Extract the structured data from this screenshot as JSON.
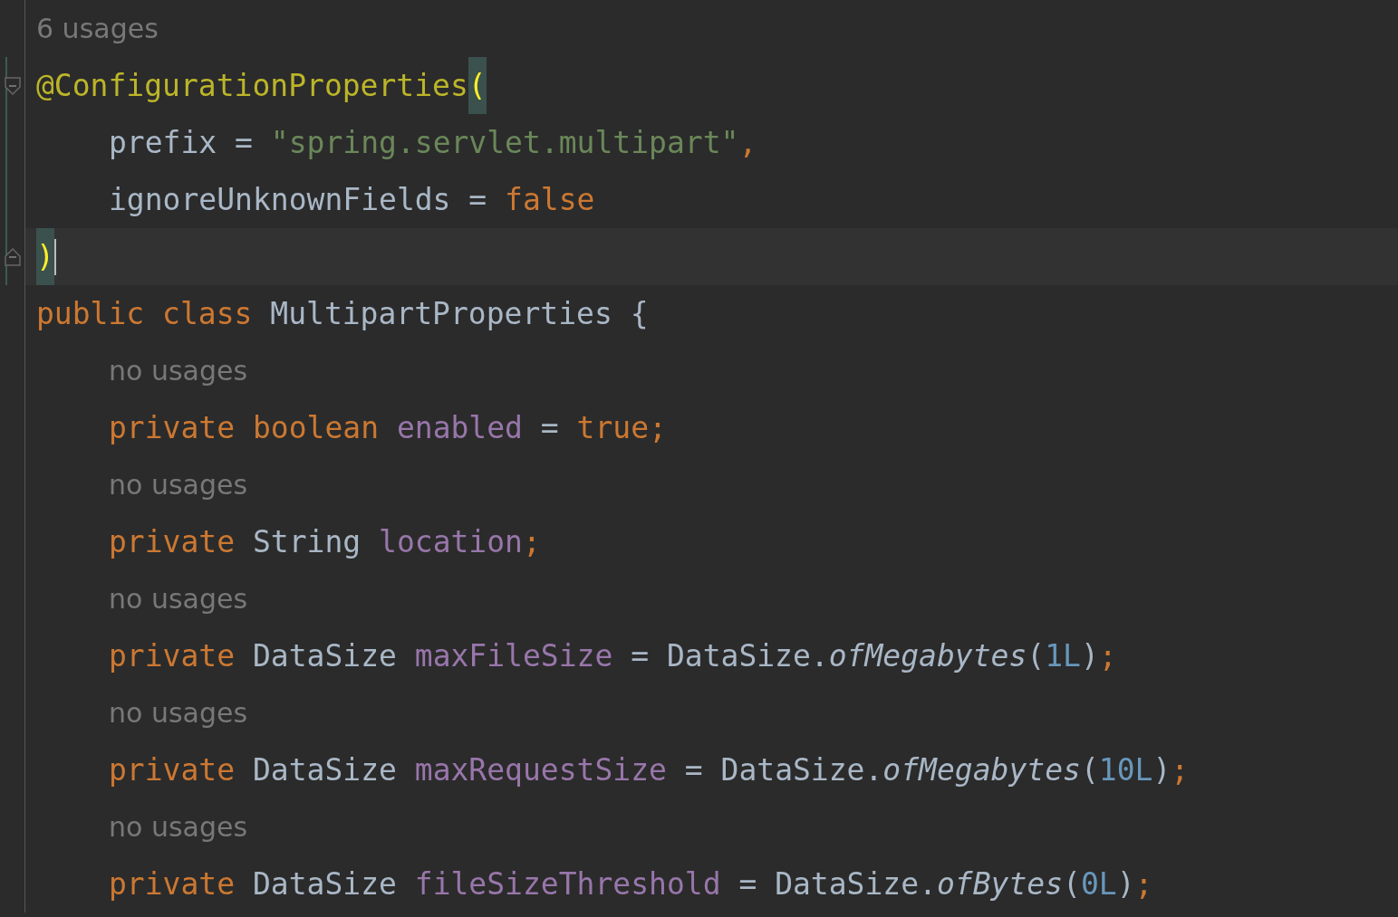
{
  "editor": {
    "lines": [
      {
        "kind": "hint",
        "current": false,
        "changed": false,
        "tokens": [
          {
            "text": "6 usages",
            "kind": "hint"
          }
        ]
      },
      {
        "kind": "code",
        "current": false,
        "changed": true,
        "fold_start": true,
        "tokens": [
          {
            "text": "@ConfigurationProperties",
            "kind": "annotation"
          },
          {
            "text": "(",
            "kind": "brace-match"
          }
        ],
        "children": [
          {
            "kind": "code",
            "current": false,
            "changed": true,
            "tokens": [
              {
                "text": "prefix",
                "kind": "plain"
              },
              {
                "text": " = ",
                "kind": "plain"
              },
              {
                "text": "\"spring.servlet.multipart\"",
                "kind": "string"
              },
              {
                "text": ",",
                "kind": "keyword"
              }
            ]
          },
          {
            "kind": "code",
            "current": false,
            "changed": true,
            "tokens": [
              {
                "text": "ignoreUnknownFields",
                "kind": "plain"
              },
              {
                "text": " = ",
                "kind": "plain"
              },
              {
                "text": "false",
                "kind": "keyword"
              }
            ]
          }
        ]
      },
      {
        "kind": "code",
        "current": true,
        "changed": true,
        "fold_end": true,
        "tokens": [
          {
            "text": ")",
            "kind": "brace-match"
          }
        ]
      },
      {
        "kind": "code",
        "current": false,
        "changed": false,
        "tokens": [
          {
            "text": "public class ",
            "kind": "keyword"
          },
          {
            "text": "MultipartProperties {",
            "kind": "plain"
          }
        ],
        "children": [
          {
            "kind": "hint",
            "current": false,
            "changed": false,
            "tokens": [
              {
                "text": "no usages",
                "kind": "hint"
              }
            ]
          },
          {
            "kind": "code",
            "current": false,
            "changed": false,
            "tokens": [
              {
                "text": "private boolean ",
                "kind": "keyword"
              },
              {
                "text": "enabled",
                "kind": "field"
              },
              {
                "text": " = ",
                "kind": "plain"
              },
              {
                "text": "true;",
                "kind": "keyword"
              }
            ]
          },
          {
            "kind": "hint",
            "current": false,
            "changed": false,
            "tokens": [
              {
                "text": "no usages",
                "kind": "hint"
              }
            ]
          },
          {
            "kind": "code",
            "current": false,
            "changed": false,
            "tokens": [
              {
                "text": "private ",
                "kind": "keyword"
              },
              {
                "text": "String ",
                "kind": "plain"
              },
              {
                "text": "location",
                "kind": "field"
              },
              {
                "text": ";",
                "kind": "keyword"
              }
            ]
          },
          {
            "kind": "hint",
            "current": false,
            "changed": false,
            "tokens": [
              {
                "text": "no usages",
                "kind": "hint"
              }
            ]
          },
          {
            "kind": "code",
            "current": false,
            "changed": false,
            "tokens": [
              {
                "text": "private ",
                "kind": "keyword"
              },
              {
                "text": "DataSize ",
                "kind": "plain"
              },
              {
                "text": "maxFileSize",
                "kind": "field"
              },
              {
                "text": " = DataSize.",
                "kind": "plain"
              },
              {
                "text": "ofMegabytes",
                "kind": "static-method"
              },
              {
                "text": "(",
                "kind": "plain"
              },
              {
                "text": "1L",
                "kind": "number"
              },
              {
                "text": ")",
                "kind": "plain"
              },
              {
                "text": ";",
                "kind": "keyword"
              }
            ]
          },
          {
            "kind": "hint",
            "current": false,
            "changed": false,
            "tokens": [
              {
                "text": "no usages",
                "kind": "hint"
              }
            ]
          },
          {
            "kind": "code",
            "current": false,
            "changed": false,
            "tokens": [
              {
                "text": "private ",
                "kind": "keyword"
              },
              {
                "text": "DataSize ",
                "kind": "plain"
              },
              {
                "text": "maxRequestSize",
                "kind": "field"
              },
              {
                "text": " = DataSize.",
                "kind": "plain"
              },
              {
                "text": "ofMegabytes",
                "kind": "static-method"
              },
              {
                "text": "(",
                "kind": "plain"
              },
              {
                "text": "10L",
                "kind": "number"
              },
              {
                "text": ")",
                "kind": "plain"
              },
              {
                "text": ";",
                "kind": "keyword"
              }
            ]
          },
          {
            "kind": "hint",
            "current": false,
            "changed": false,
            "tokens": [
              {
                "text": "no usages",
                "kind": "hint"
              }
            ]
          },
          {
            "kind": "code",
            "current": false,
            "changed": false,
            "tokens": [
              {
                "text": "private ",
                "kind": "keyword"
              },
              {
                "text": "DataSize ",
                "kind": "plain"
              },
              {
                "text": "fileSizeThreshold",
                "kind": "field"
              },
              {
                "text": " = DataSize.",
                "kind": "plain"
              },
              {
                "text": "ofBytes",
                "kind": "static-method"
              },
              {
                "text": "(",
                "kind": "plain"
              },
              {
                "text": "0L",
                "kind": "number"
              },
              {
                "text": ")",
                "kind": "plain"
              },
              {
                "text": ";",
                "kind": "keyword"
              }
            ]
          }
        ]
      }
    ]
  }
}
